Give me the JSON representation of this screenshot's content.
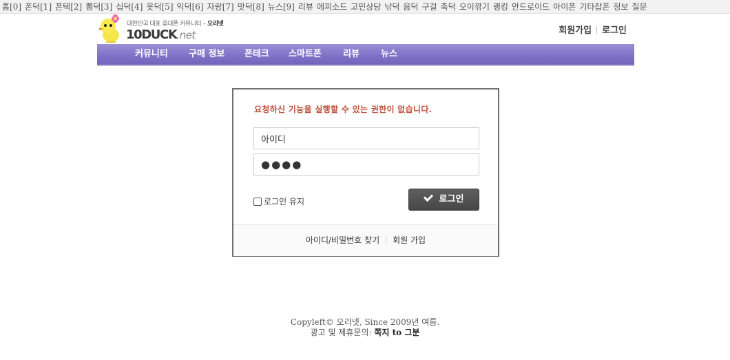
{
  "topbar": {
    "links": [
      "홈[0]",
      "폰덕[1]",
      "폰텍[2]",
      "뽐덕[3]",
      "십덕[4]",
      "옷덕[5]",
      "익덕[6]",
      "자랑[7]",
      "맛덕[8]",
      "뉴스[9]",
      "리뷰",
      "에피소드",
      "고민상담",
      "낚덕",
      "음덕",
      "구걸",
      "축덕",
      "오이깎기",
      "랭킹",
      "안드로이드",
      "아이폰",
      "기타잡폰",
      "정보",
      "질문"
    ]
  },
  "header": {
    "tagline_prefix": "대한민국 대표 휴대폰 커뮤니티 – ",
    "tagline_brand": "오리넷",
    "logo_name": "10DUCK",
    "logo_ext": ".net",
    "signup_label": "회원가입",
    "login_label": "로그인"
  },
  "nav": {
    "items": [
      "커뮤니티",
      "구매 정보",
      "폰테크",
      "스마트폰",
      "리뷰",
      "뉴스"
    ]
  },
  "login": {
    "error": "요청하신 기능을 실행할 수 있는 권한이 없습니다.",
    "id_value": "아이디",
    "pw_value": "●●●●",
    "remember_label": "로그인 유지",
    "button_label": "로그인",
    "find_label": "아이디/비밀번호 찾기",
    "join_label": "회원 가입"
  },
  "footer": {
    "line1": "Copyleft© 오리넷, Since 2009년 여름.",
    "line2_prefix": "광고 및 제휴문의: ",
    "line2_link": "쪽지 to 그분"
  },
  "colors": {
    "nav": "#7e70c6",
    "error": "#c0513d",
    "button": "#4f4f4f"
  }
}
